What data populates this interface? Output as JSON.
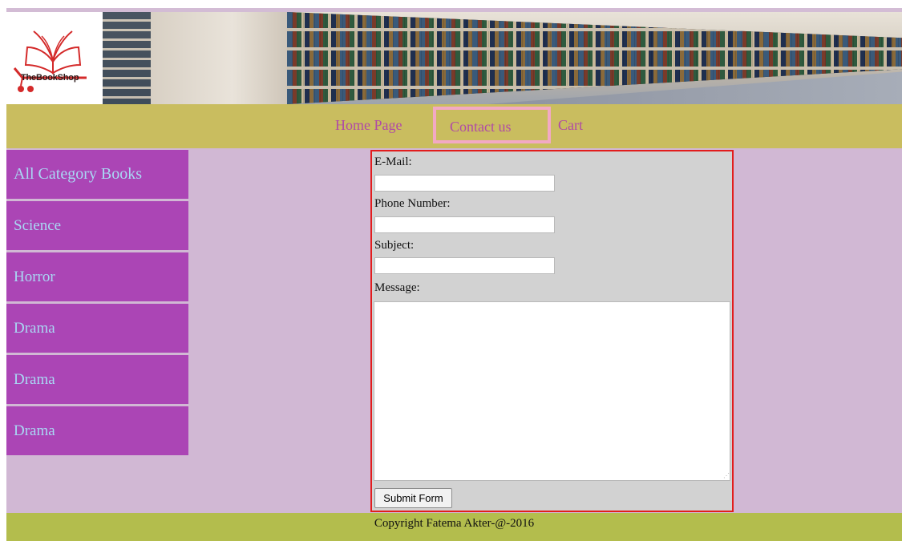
{
  "header": {
    "logo_text": "TheBookShop"
  },
  "nav": {
    "items": [
      {
        "label": "Home Page"
      },
      {
        "label": "Contact us"
      },
      {
        "label": "Cart"
      }
    ],
    "active": "Contact us"
  },
  "sidebar": {
    "items": [
      {
        "label": "All Category Books"
      },
      {
        "label": "Science"
      },
      {
        "label": "Horror"
      },
      {
        "label": "Drama"
      },
      {
        "label": "Drama"
      },
      {
        "label": "Drama"
      }
    ]
  },
  "form": {
    "fields": [
      {
        "label": "E-Mail:",
        "value": "",
        "placeholder": ""
      },
      {
        "label": "Phone Number:",
        "value": "",
        "placeholder": ""
      },
      {
        "label": "Subject:",
        "value": "",
        "placeholder": ""
      }
    ],
    "message": {
      "label": "Message:",
      "value": "",
      "placeholder": ""
    },
    "submit_label": "Submit Form"
  },
  "footer": {
    "text": "Copyright Fatema Akter-@-2016"
  },
  "colors": {
    "page_bg": "#d1b8d4",
    "nav_bg": "#c9bd5f",
    "nav_link": "#b04aa6",
    "active_border": "#f2a9c4",
    "sidebar_bg": "#ab45b5",
    "sidebar_text": "#a9d8f4",
    "form_bg": "#d2d2d2",
    "form_border": "#e21d1d",
    "footer_bg": "#b3bd4d"
  }
}
